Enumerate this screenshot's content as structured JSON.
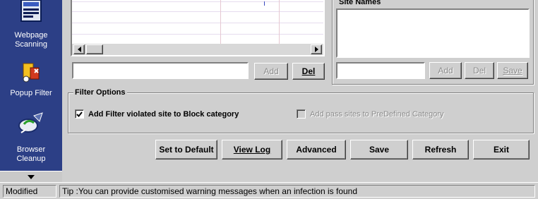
{
  "sidebar": {
    "items": [
      {
        "label_line1": "Webpage",
        "label_line2": "Scanning",
        "icon": "webpage-scanning-icon"
      },
      {
        "label_line1": "Popup Filter",
        "icon": "popup-filter-icon"
      },
      {
        "label_line1": "Browser",
        "label_line2": "Cleanup",
        "icon": "browser-cleanup-icon"
      }
    ],
    "more_icon": "chevron-down-icon"
  },
  "url_panel": {
    "input_value": "",
    "add_label": "Add",
    "del_label": "Del"
  },
  "site_panel": {
    "title": "Site Names",
    "input_value": "",
    "add_label": "Add",
    "del_label": "Del",
    "save_label": "Save"
  },
  "filter_options": {
    "title": "Filter Options",
    "block_violated": {
      "label": "Add Filter violated site to Block category",
      "checked": true
    },
    "add_pass": {
      "label": "Add pass sites to PreDefined Category",
      "checked": false
    }
  },
  "actions": {
    "set_default": "Set to Default",
    "view_log": "View Log",
    "advanced": "Advanced",
    "save": "Save",
    "refresh": "Refresh",
    "exit": "Exit"
  },
  "status": {
    "state": "Modified",
    "tip": "Tip :You can provide customised warning messages when an infection is found"
  },
  "colors": {
    "rail": "#2c3f86",
    "face": "#cfcfcf"
  }
}
